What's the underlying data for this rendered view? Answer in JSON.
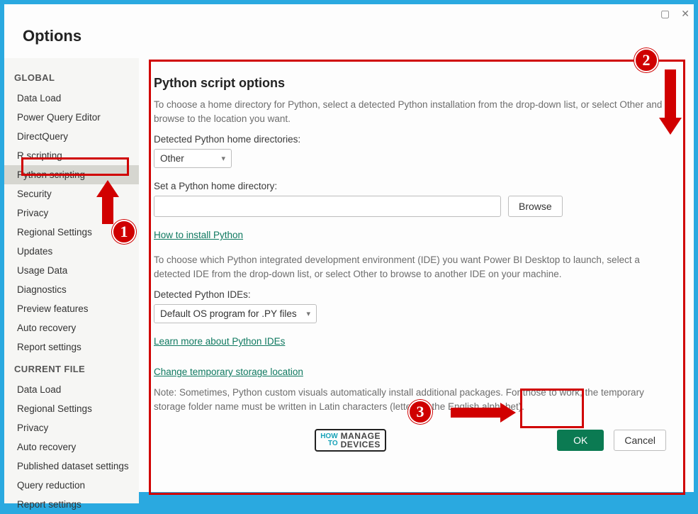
{
  "titlebar": {
    "maximize_glyph": "▢",
    "close_glyph": "✕"
  },
  "dialog_title": "Options",
  "sidebar": {
    "global_header": "GLOBAL",
    "current_file_header": "CURRENT FILE",
    "global_items": [
      "Data Load",
      "Power Query Editor",
      "DirectQuery",
      "R scripting",
      "Python scripting",
      "Security",
      "Privacy",
      "Regional Settings",
      "Updates",
      "Usage Data",
      "Diagnostics",
      "Preview features",
      "Auto recovery",
      "Report settings"
    ],
    "selected_index": 4,
    "current_file_items": [
      "Data Load",
      "Regional Settings",
      "Privacy",
      "Auto recovery",
      "Published dataset settings",
      "Query reduction",
      "Report settings"
    ]
  },
  "main": {
    "heading": "Python script options",
    "intro": "To choose a home directory for Python, select a detected Python installation from the drop-down list, or select Other and browse to the location you want.",
    "home_dirs_label": "Detected Python home directories:",
    "home_dirs_value": "Other",
    "set_home_label": "Set a Python home directory:",
    "set_home_value": "",
    "browse_label": "Browse",
    "install_link": "How to install Python",
    "ide_intro": "To choose which Python integrated development environment (IDE) you want Power BI Desktop to launch, select a detected IDE from the drop-down list, or select Other to browse to another IDE on your machine.",
    "ide_label": "Detected Python IDEs:",
    "ide_value": "Default OS program for .PY files",
    "ide_link": "Learn more about Python IDEs",
    "storage_link": "Change temporary storage location",
    "note": "Note: Sometimes, Python custom visuals automatically install additional packages. For those to work, the temporary storage folder name must be written in Latin characters (letters in the English alphabet).",
    "ok_label": "OK",
    "cancel_label": "Cancel"
  },
  "logo": {
    "how": "HOW",
    "to": "TO",
    "line1": "MANAGE",
    "line2": "DEVICES"
  },
  "annotations": {
    "n1": "1",
    "n2": "2",
    "n3": "3"
  },
  "colors": {
    "accent": "#0f7960",
    "danger": "#d00000",
    "ok_button": "#0b7a52"
  }
}
